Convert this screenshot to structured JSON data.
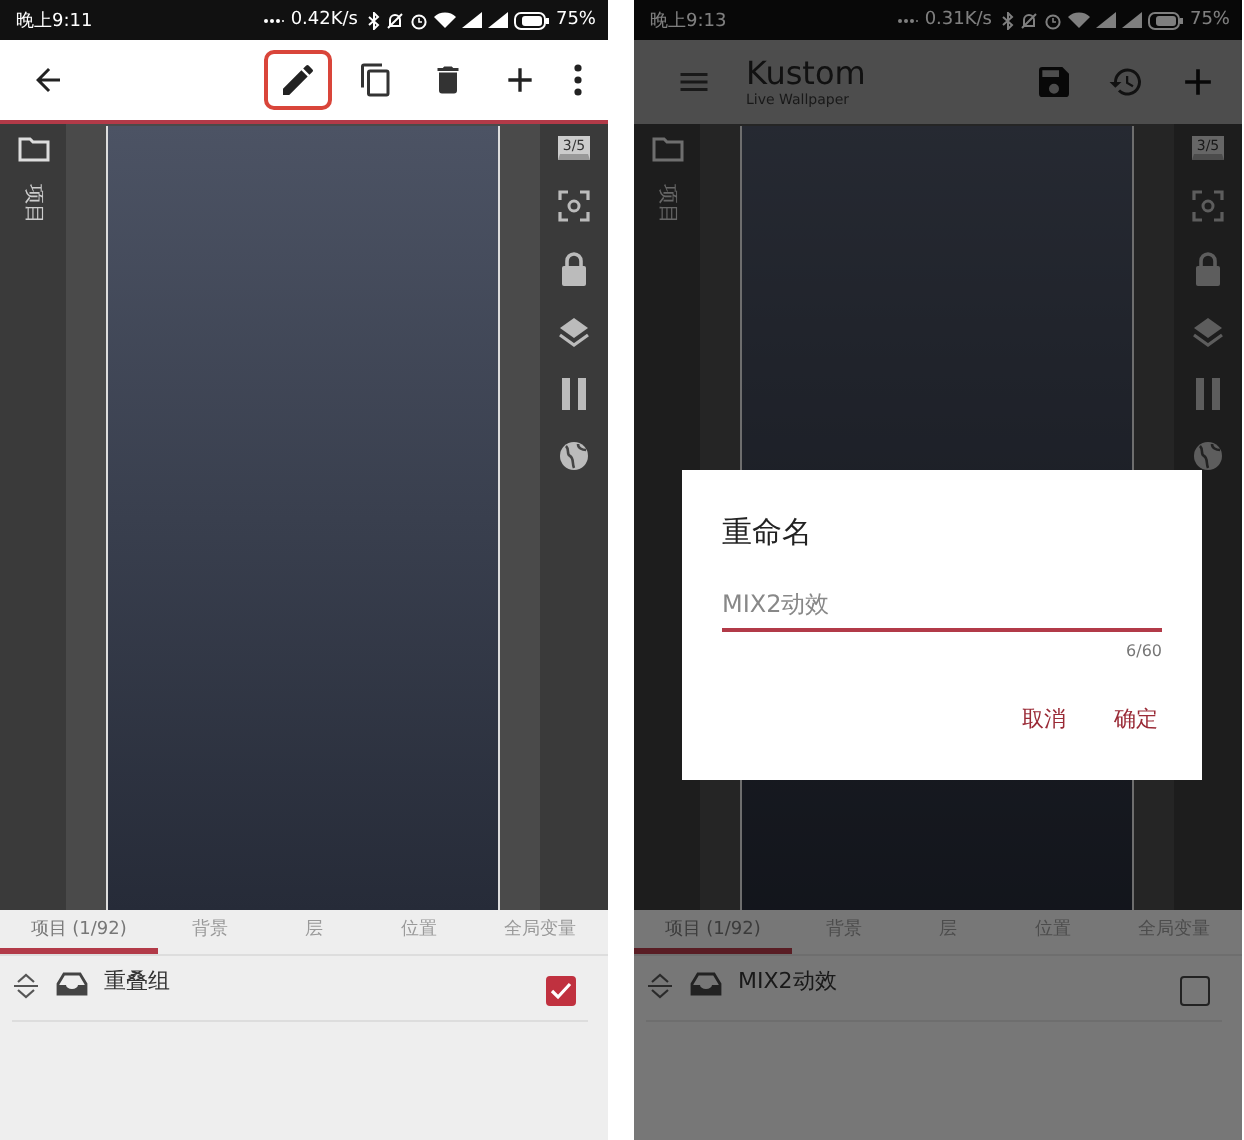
{
  "screens": [
    {
      "status_bar": {
        "time": "晚上9:11",
        "speed": "0.42K/s",
        "battery": "75%"
      },
      "toolbar": {
        "kind": "editor",
        "edit_highlighted": true
      },
      "side_label": "项目",
      "page_badge": "3/5",
      "tabs": [
        {
          "label": "项目 (1/92)",
          "selected": true
        },
        {
          "label": "背景",
          "selected": false
        },
        {
          "label": "层",
          "selected": false
        },
        {
          "label": "位置",
          "selected": false
        },
        {
          "label": "全局变量",
          "selected": false
        }
      ],
      "items": [
        {
          "name": "重叠组",
          "checked": true
        }
      ]
    },
    {
      "status_bar": {
        "time": "晚上9:13",
        "speed": "0.31K/s",
        "battery": "75%"
      },
      "toolbar": {
        "kind": "main",
        "title": "Kustom",
        "subtitle": "Live Wallpaper"
      },
      "side_label": "项目",
      "page_badge": "3/5",
      "dimmed": true,
      "tabs": [
        {
          "label": "项目 (1/92)",
          "selected": true
        },
        {
          "label": "背景",
          "selected": false
        },
        {
          "label": "层",
          "selected": false
        },
        {
          "label": "位置",
          "selected": false
        },
        {
          "label": "全局变量",
          "selected": false
        }
      ],
      "items": [
        {
          "name": "MIX2动效",
          "checked": false
        }
      ],
      "dialog": {
        "title": "重命名",
        "value": "MIX2动效",
        "counter": "6/60",
        "buttons": [
          "取消",
          "确定"
        ]
      }
    }
  ]
}
